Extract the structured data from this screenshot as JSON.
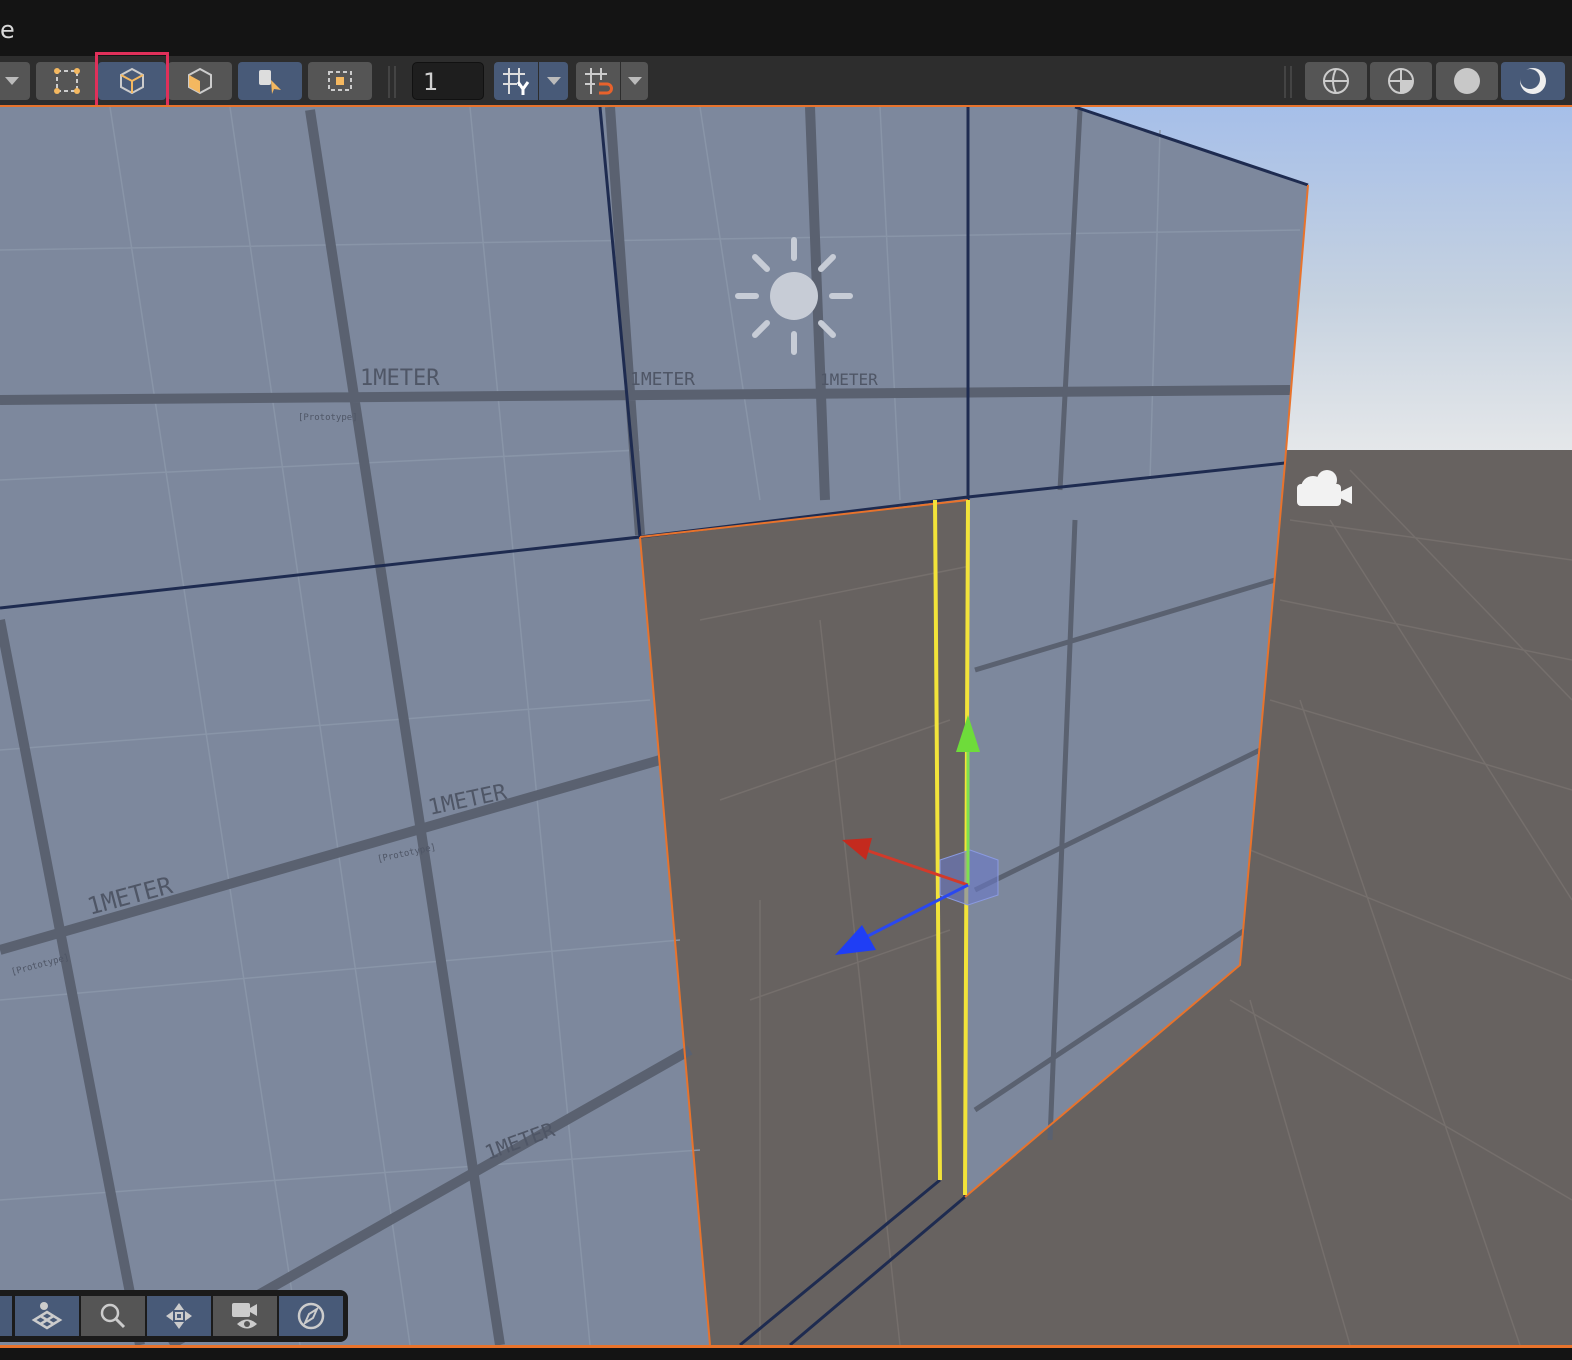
{
  "window": {
    "title": "e"
  },
  "toolbar": {
    "mode_dropdown": "chevron-down-icon",
    "select_mode_vertex": "vertex-select-icon",
    "select_mode_object": "object-cube-icon",
    "select_mode_face": "face-cube-icon",
    "snap_value": "1",
    "shading_modes": [
      "wireframe",
      "solid-xray",
      "solid",
      "material-preview"
    ]
  },
  "viewport": {
    "texture_label": "1METER",
    "texture_sublabel": "[Prototype]",
    "colors": {
      "wall": "#7d889c",
      "ground": "#686360",
      "sky_top": "#a9c0e8",
      "selection": "#e8732c",
      "accent": "#485a78"
    }
  },
  "navigation": {
    "buttons": [
      "grid-view",
      "zoom",
      "pan",
      "camera-view",
      "orbit"
    ]
  }
}
